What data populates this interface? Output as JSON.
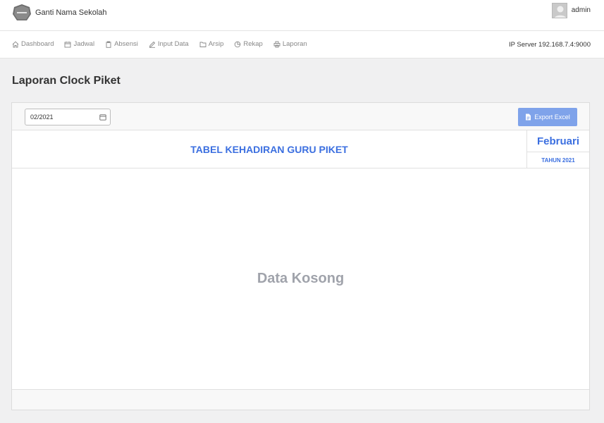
{
  "header": {
    "brand_name": "Ganti Nama Sekolah",
    "user_name": "admin"
  },
  "nav": {
    "items": [
      {
        "label": "Dashboard",
        "icon": "home-icon"
      },
      {
        "label": "Jadwal",
        "icon": "calendar-icon"
      },
      {
        "label": "Absensi",
        "icon": "clipboard-icon"
      },
      {
        "label": "Input Data",
        "icon": "pencil-icon"
      },
      {
        "label": "Arsip",
        "icon": "folder-icon"
      },
      {
        "label": "Rekap",
        "icon": "pie-chart-icon"
      },
      {
        "label": "Laporan",
        "icon": "printer-icon"
      }
    ],
    "ip_server": "IP Server 192.168.7.4:9000"
  },
  "page": {
    "title": "Laporan Clock Piket"
  },
  "toolbar": {
    "month_value": "02/2021",
    "export_label": "Export Excel"
  },
  "report": {
    "title": "TABEL KEHADIRAN GURU PIKET",
    "month": "Februari",
    "year": "TAHUN 2021",
    "empty_message": "Data Kosong"
  },
  "colors": {
    "accent": "#3b6fe0",
    "export_button": "#7fa3ea",
    "background": "#f0f0f1"
  }
}
